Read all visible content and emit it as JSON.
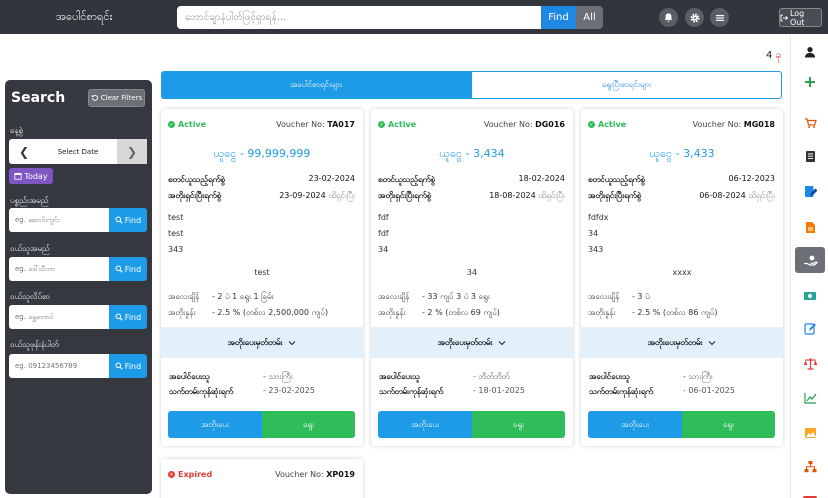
{
  "header": {
    "title": "အပေါင်စာရင်း",
    "search_placeholder": "ဘောင်ချာနံပါတ်ဖြင့်ရှာရန်...",
    "find_label": "Find",
    "all_label": "All",
    "logout_label": "Log Out",
    "icons": [
      "bell-icon",
      "gear-icon",
      "menu-icon"
    ]
  },
  "result_count": {
    "value": "4",
    "suffix": "ခု"
  },
  "filter": {
    "title": "Search",
    "clear_label": "Clear Filters",
    "date_label": "နေ့စွဲ",
    "select_date": "Select Date",
    "today_label": "Today",
    "fields": [
      {
        "label": "ပစ္စည်းအမည်",
        "placeholder": "eg. ဆောင်းကွင်း",
        "button": "Find"
      },
      {
        "label": "ဝယ်သူအမည်",
        "placeholder": "eg. ဒေါ်သီတာ",
        "button": "Find"
      },
      {
        "label": "ဝယ်သူလိပ်စာ",
        "placeholder": "eg. ရွှေတောင်",
        "button": "Find"
      },
      {
        "label": "ဝယ်သူဖုန်းနံပါတ်",
        "placeholder": "eg. 09123456789",
        "button": "Find"
      }
    ]
  },
  "tabs": {
    "active": "အပေါင်စာရင်းများ",
    "inactive": "ရွေးပြီးစာရင်းများ"
  },
  "cards": [
    {
      "status": "Active",
      "voucher_label": "Voucher No:",
      "voucher": "TA017",
      "amount": "ယူငွေ - 99,999,999",
      "start_label": "စတင်ယူသည့်ရက်စွဲ",
      "start_date": "23-02-2024",
      "end_label": "အတိုးရှင်းပြီးရက်စွဲ",
      "end_date": "23-09-2024",
      "end_note": "ထိရှင်းပြီး",
      "notes": [
        "test",
        "test",
        "343"
      ],
      "center_note": "test",
      "weight_label": "အလေးချိန်",
      "weight": "- 2 ပဲ 1 ရွေး 1 ခြမ်း",
      "rate_label": "အတိုးနှုန်း",
      "rate": "- 2.5 % (တစ်လ 2,500,000 ကျပ်)",
      "expand_label": "အတိုးပေးမှတ်တမ်း",
      "payer_label": "အပေါင်ပေးသူ",
      "payer": "- သားကြီး",
      "last_label": "သက်တမ်းကုန်ဆုံးရက်",
      "last_date": "- 23-02-2025",
      "btn_left": "အတိုးပေး",
      "btn_right": "ရွေး"
    },
    {
      "status": "Active",
      "voucher_label": "Voucher No:",
      "voucher": "DG016",
      "amount": "ယူငွေ - 3,434",
      "start_label": "စတင်ယူသည့်ရက်စွဲ",
      "start_date": "18-02-2024",
      "end_label": "အတိုးရှင်းပြီးရက်စွဲ",
      "end_date": "18-08-2024",
      "end_note": "ထိရှင်းပြီး",
      "notes": [
        "fdf",
        "fdf",
        "34"
      ],
      "center_note": "34",
      "weight_label": "အလေးချိန်",
      "weight": "- 33 ကျပ် 3 ပဲ 3 ရွေး",
      "rate_label": "အတိုးနှုန်း",
      "rate": "- 2 % (တစ်လ 69 ကျပ်)",
      "expand_label": "အတိုးပေးမှတ်တမ်း",
      "payer_label": "အပေါင်ပေးသူ",
      "payer": "- ဘိတ်ဘိတ်",
      "last_label": "သက်တမ်းကုန်ဆုံးရက်",
      "last_date": "- 18-01-2025",
      "btn_left": "အတိုးပေး",
      "btn_right": "ရွေး"
    },
    {
      "status": "Active",
      "voucher_label": "Voucher No:",
      "voucher": "MG018",
      "amount": "ယူငွေ - 3,433",
      "start_label": "စတင်ယူသည့်ရက်စွဲ",
      "start_date": "06-12-2023",
      "end_label": "အတိုးရှင်းပြီးရက်စွဲ",
      "end_date": "06-08-2024",
      "end_note": "ထိရှင်းပြီး",
      "notes": [
        "fdfdx",
        "34",
        "343"
      ],
      "center_note": "xxxx",
      "weight_label": "အလေးချိန်",
      "weight": "- 3 ပဲ",
      "rate_label": "အတိုးနှုန်း",
      "rate": "- 2.5 % (တစ်လ 86 ကျပ်)",
      "expand_label": "အတိုးပေးမှတ်တမ်း",
      "payer_label": "အပေါင်ပေးသူ",
      "payer": "- သားကြီး",
      "last_label": "သက်တမ်းကုန်ဆုံးရက်",
      "last_date": "- 06-01-2025",
      "btn_left": "အတိုးပေး",
      "btn_right": "ရွေး"
    },
    {
      "status": "Expired",
      "voucher_label": "Voucher No:",
      "voucher": "XP019"
    }
  ],
  "colors": {
    "topbar": "#32353b",
    "accent": "#1e9be6",
    "green": "#2ebd59",
    "active_status": "#2ebd59",
    "expired_status": "#e53935"
  },
  "rail_icons": [
    "user-icon",
    "plus-icon",
    "cart-icon",
    "document-icon",
    "edit-list-icon",
    "report-icon",
    "pawn-hand-icon",
    "cash-icon",
    "edit-icon",
    "scale-icon",
    "chart-icon",
    "image-icon",
    "hierarchy-icon"
  ]
}
